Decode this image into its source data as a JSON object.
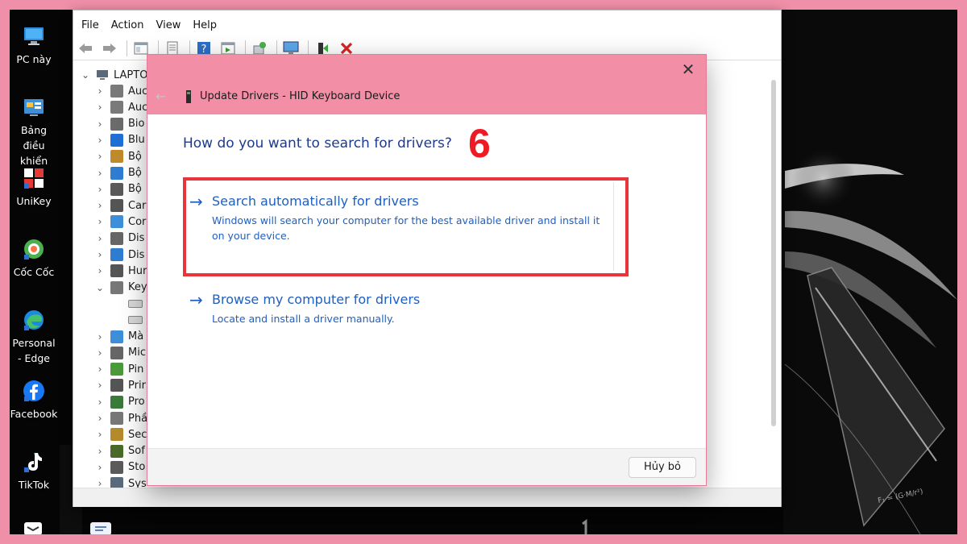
{
  "desktop": {
    "icons": [
      {
        "label": "PC này",
        "icon": "pc-icon"
      },
      {
        "label": "Bảng điều khiển",
        "icon": "control-panel-icon"
      },
      {
        "label": "UniKey",
        "icon": "unikey-icon"
      },
      {
        "label": "Cốc Cốc",
        "icon": "coccoc-icon"
      },
      {
        "label": "Personal - Edge",
        "icon": "edge-icon"
      },
      {
        "label": "Facebook",
        "icon": "facebook-icon"
      },
      {
        "label": "TikTok",
        "icon": "tiktok-icon"
      }
    ]
  },
  "device_manager": {
    "menu": [
      "File",
      "Action",
      "View",
      "Help"
    ],
    "tree_root": "LAPTOP",
    "tree_items": [
      "Auc",
      "Auc",
      "Bio",
      "Blu",
      "Bộ",
      "Bộ",
      "Bộ",
      "Car",
      "Cor",
      "Dis",
      "Dis",
      "Hur",
      "Key",
      "",
      "",
      "Mà",
      "Mic",
      "Pin",
      "Prir",
      "Pro",
      "Phầ",
      "Sec",
      "Sof",
      "Sto",
      "Sys"
    ]
  },
  "dialog": {
    "title": "Update Drivers - HID Keyboard Device",
    "question": "How do you want to search for drivers?",
    "step_number": "6",
    "options": [
      {
        "title": "Search automatically for drivers",
        "description": "Windows will search your computer for the best available driver and install it on your device."
      },
      {
        "title": "Browse my computer for drivers",
        "description": "Locate and install a driver manually."
      }
    ],
    "cancel_label": "Hủy bỏ",
    "close_glyph": "✕"
  },
  "colors": {
    "frame_pink": "#f08fa8",
    "dialog_header": "#f28ea6",
    "link_blue": "#1f5fbf",
    "highlight_red": "#e8343a",
    "step_red": "#ee1b24"
  }
}
